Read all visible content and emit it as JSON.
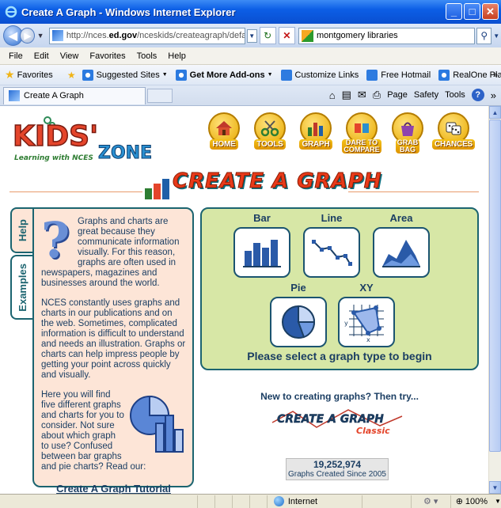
{
  "window": {
    "title": "Create A Graph - Windows Internet Explorer",
    "minimize": "_",
    "maximize": "□",
    "close": "✕"
  },
  "address_bar": {
    "url_prefix": "http://nces.",
    "url_domain": "ed.gov",
    "url_rest": "/nceskids/createagraph/defau",
    "search_value": "montgomery libraries"
  },
  "menu": [
    "File",
    "Edit",
    "View",
    "Favorites",
    "Tools",
    "Help"
  ],
  "favorites_bar": {
    "favorites_label": "Favorites",
    "items": [
      {
        "label": "Suggested Sites",
        "has_dropdown": true,
        "icon": "ie-icon"
      },
      {
        "label": "Get More Add-ons",
        "has_dropdown": true,
        "icon": "ie-icon",
        "bold": true
      },
      {
        "label": "Customize Links",
        "icon": "msn-icon"
      },
      {
        "label": "Free Hotmail",
        "icon": "msn-icon"
      },
      {
        "label": "RealOne Player",
        "icon": "ie-icon"
      }
    ]
  },
  "tabs": {
    "active_tab": "Create A Graph",
    "commands": [
      "Page",
      "Safety",
      "Tools"
    ]
  },
  "status": {
    "zone": "Internet",
    "zoom": "100%"
  },
  "kidszone": {
    "logo_text": "KIDS'",
    "logo_zone": "ZONE",
    "logo_tagline": "Learning with NCES",
    "nav": [
      {
        "label": "HOME",
        "icon": "house-icon"
      },
      {
        "label": "TOOLS",
        "icon": "scissors-icon"
      },
      {
        "label": "GRAPH",
        "icon": "bar-chart-icon"
      },
      {
        "label": "DARE TO COMPARE",
        "line1": "DARE TO",
        "line2": "COMPARE",
        "icon": "compare-icon"
      },
      {
        "label": "GRAB BAG",
        "line1": "GRAB",
        "line2": "BAG",
        "icon": "bag-icon"
      },
      {
        "label": "CHANCES",
        "icon": "dice-icon"
      }
    ]
  },
  "page": {
    "heading": "CREATE A GRAPH",
    "side_tabs": [
      "Help",
      "Examples"
    ],
    "help_paragraph_1": "Graphs and charts are great because they communicate information visually. For this reason, graphs are often used in newspapers, magazines and businesses around the world.",
    "help_paragraph_2": "NCES constantly uses graphs and charts in our publications and on the web. Sometimes, complicated information is difficult to understand and needs an illustration. Graphs or charts can help impress people by getting your point across quickly and visually.",
    "help_paragraph_3": "Here you will find five different graphs and charts for you to consider. Not sure about which graph to use? Confused between bar graphs and pie charts? Read our:",
    "tutorial_link": "Create A Graph Tutorial",
    "graph_types": [
      {
        "name": "Bar",
        "icon": "bar-graph-icon"
      },
      {
        "name": "Line",
        "icon": "line-graph-icon"
      },
      {
        "name": "Area",
        "icon": "area-graph-icon"
      },
      {
        "name": "Pie",
        "icon": "pie-chart-icon"
      },
      {
        "name": "XY",
        "icon": "xy-plot-icon"
      }
    ],
    "select_prompt": "Please select a graph type to begin",
    "new_to_text": "New to creating graphs? Then try...",
    "classic_line1": "CREATE A GRAPH",
    "classic_line2": "Classic",
    "counter_value": "19,252,974",
    "counter_label": "Graphs Created Since 2005"
  },
  "colors": {
    "panel_peach": "#fde5d7",
    "panel_green": "#d7e7a6",
    "dark_teal": "#1b6470",
    "text_navy": "#1b3e63",
    "heading_red": "#e83a1a"
  }
}
